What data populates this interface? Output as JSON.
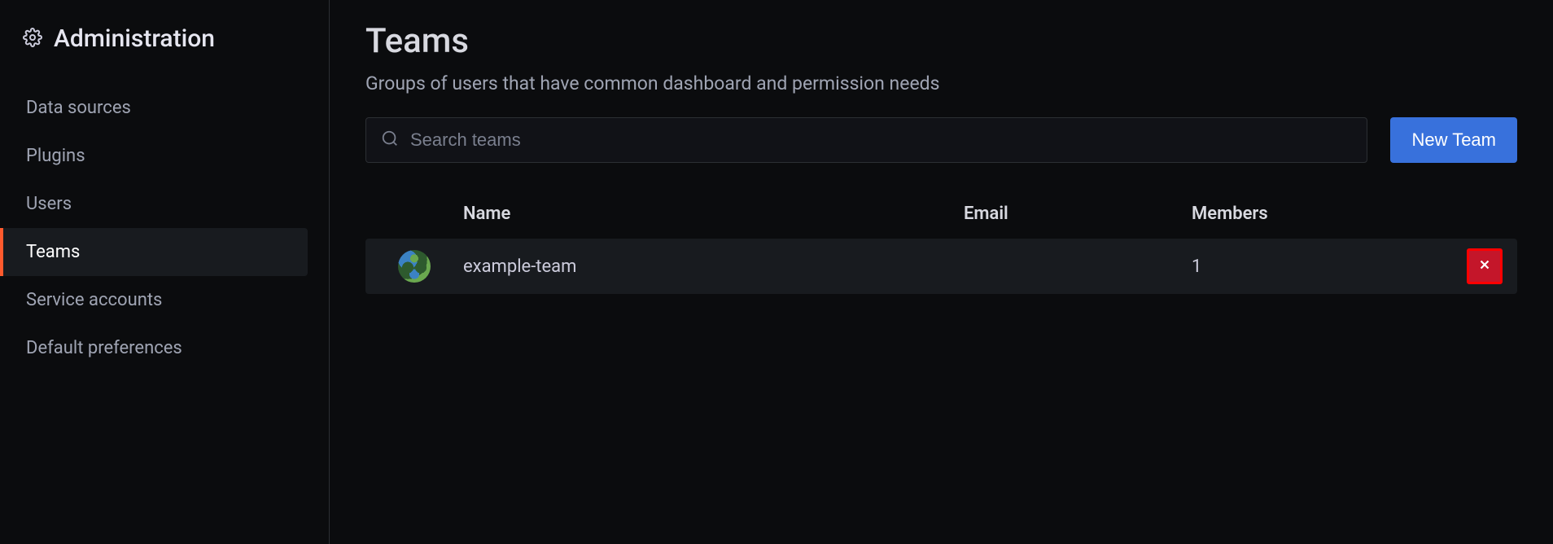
{
  "sidebar": {
    "title": "Administration",
    "items": [
      {
        "label": "Data sources",
        "active": false
      },
      {
        "label": "Plugins",
        "active": false
      },
      {
        "label": "Users",
        "active": false
      },
      {
        "label": "Teams",
        "active": true
      },
      {
        "label": "Service accounts",
        "active": false
      },
      {
        "label": "Default preferences",
        "active": false
      }
    ]
  },
  "main": {
    "title": "Teams",
    "subtitle": "Groups of users that have common dashboard and permission needs",
    "search_placeholder": "Search teams",
    "new_team_label": "New Team",
    "table": {
      "headers": {
        "name": "Name",
        "email": "Email",
        "members": "Members"
      },
      "rows": [
        {
          "name": "example-team",
          "email": "",
          "members": "1"
        }
      ]
    }
  }
}
